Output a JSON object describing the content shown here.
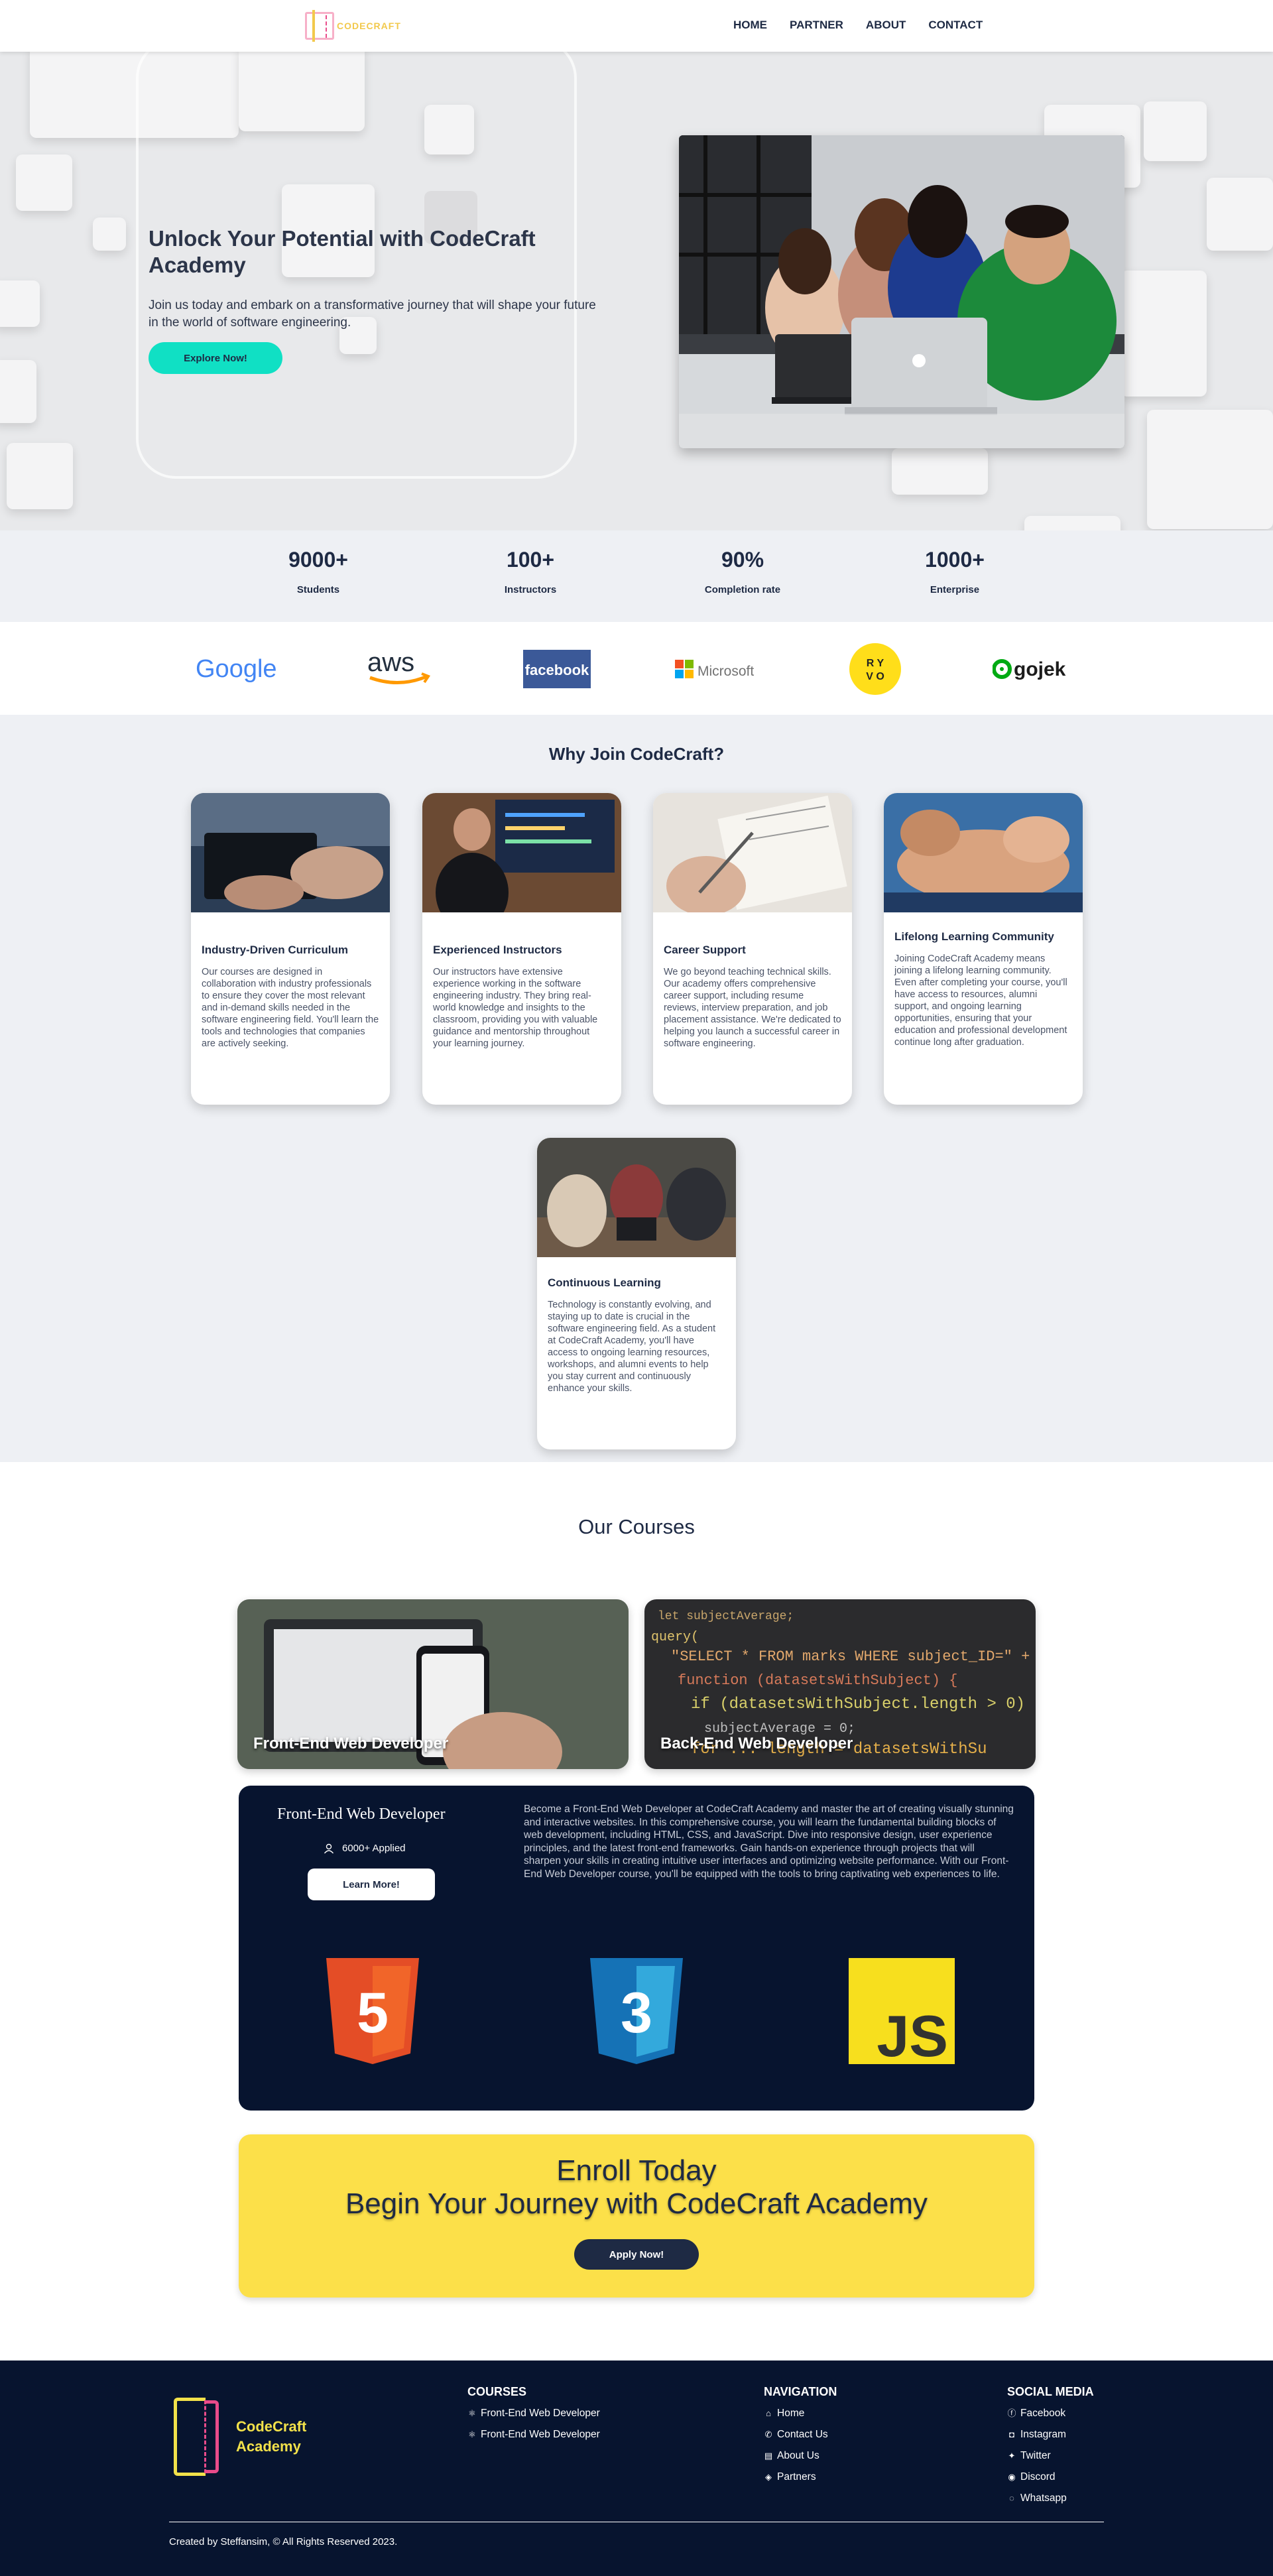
{
  "nav": {
    "logo_text": "CODECRAFT",
    "links": [
      "HOME",
      "PARTNER",
      "ABOUT",
      "CONTACT"
    ]
  },
  "hero": {
    "title": "Unlock Your Potential with CodeCraft Academy",
    "subtitle": "Join us today and embark on a transformative journey that will shape your future in the world of software engineering.",
    "cta": "Explore Now!"
  },
  "stats": [
    {
      "value": "9000+",
      "label": "Students"
    },
    {
      "value": "100+",
      "label": "Instructors"
    },
    {
      "value": "90%",
      "label": "Completion rate"
    },
    {
      "value": "1000+",
      "label": "Enterprise"
    }
  ],
  "partners": [
    "Google",
    "aws",
    "facebook",
    "Microsoft",
    "gojek"
  ],
  "why": {
    "title": "Why Join CodeCraft?",
    "cards": [
      {
        "title": "Industry-Driven Curriculum",
        "text": "Our courses are designed in collaboration with industry professionals to ensure they cover the most relevant and in-demand skills needed in the software engineering field. You'll learn the tools and technologies that companies are actively seeking."
      },
      {
        "title": "Experienced Instructors",
        "text": "Our instructors have extensive experience working in the software engineering industry. They bring real-world knowledge and insights to the classroom, providing you with valuable guidance and mentorship throughout your learning journey."
      },
      {
        "title": "Career Support",
        "text": "We go beyond teaching technical skills. Our academy offers comprehensive career support, including resume reviews, interview preparation, and job placement assistance. We're dedicated to helping you launch a successful career in software engineering."
      },
      {
        "title": "Lifelong Learning Community",
        "text": "Joining CodeCraft Academy means joining a lifelong learning community. Even after completing your course, you'll have access to resources, alumni support, and ongoing learning opportunities, ensuring that your education and professional development continue long after graduation."
      },
      {
        "title": "Continuous Learning",
        "text": "Technology is constantly evolving, and staying up to date is crucial in the software engineering field. As a student at CodeCraft Academy, you'll have access to ongoing learning resources, workshops, and alumni events to help you stay current and continuously enhance your skills."
      }
    ]
  },
  "courses": {
    "title": "Our Courses",
    "tiles": [
      "Front-End Web Developer",
      "Back-End Web Developer"
    ],
    "panel": {
      "title": "Front-End Web Developer",
      "applied": "6000+ Applied",
      "button": "Learn More!",
      "description": "Become a Front-End Web Developer at CodeCraft Academy and master the art of creating visually stunning and interactive websites. In this comprehensive course, you will learn the fundamental building blocks of web development, including HTML, CSS, and JavaScript. Dive into responsive design, user experience principles, and the latest front-end frameworks. Gain hands-on experience through projects that will sharpen your skills in creating intuitive user interfaces and optimizing website performance. With our Front-End Web Developer course, you'll be equipped with the tools to bring captivating web experiences to life.",
      "tech": [
        "5",
        "3",
        "JS"
      ]
    },
    "enroll": {
      "line1": "Enroll Today",
      "line2": "Begin Your Journey with CodeCraft Academy",
      "button": "Apply Now!"
    }
  },
  "footer": {
    "logo_line1": "CodeCraft",
    "logo_line2": "Academy",
    "courses_title": "COURSES",
    "courses": [
      "Front-End Web Developer",
      "Front-End Web Developer"
    ],
    "nav_title": "NAVIGATION",
    "nav": [
      "Home",
      "Contact Us",
      "About Us",
      "Partners"
    ],
    "social_title": "SOCIAL MEDIA",
    "social": [
      "Facebook",
      "Instagram",
      "Twitter",
      "Discord",
      "Whatsapp"
    ],
    "copyright": "Created by Steffansim, © All Rights Reserved 2023."
  },
  "colors": {
    "accent": "#10e0c4",
    "navy": "#07142f",
    "yellow": "#fce049"
  }
}
